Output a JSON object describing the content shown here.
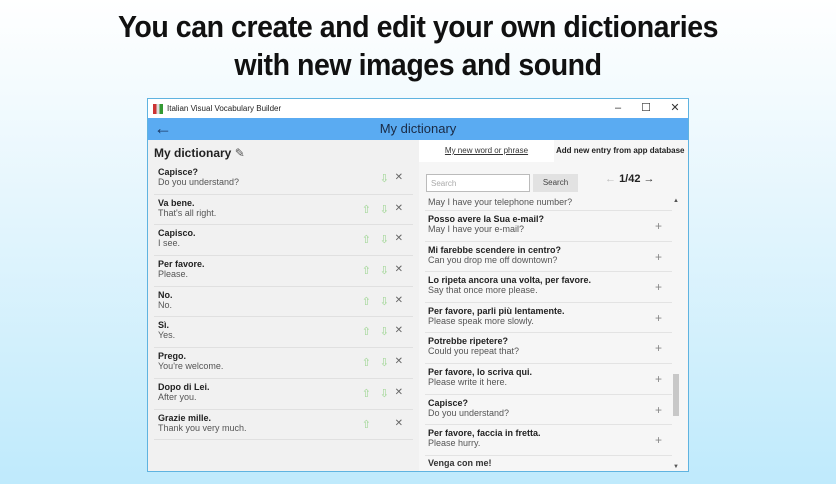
{
  "headline": [
    "You can create and edit your own dictionaries",
    "with new images and sound"
  ],
  "window": {
    "title": "Italian Visual Vocabulary Builder",
    "minimize": "–",
    "maximize": "☐",
    "close": "✕"
  },
  "header": {
    "title": "My dictionary",
    "back": "←"
  },
  "left": {
    "title": "My dictionary",
    "edit_icon": "✎",
    "items": [
      {
        "it": "Capisce?",
        "en": "Do you understand?",
        "up": false,
        "down": true
      },
      {
        "it": "Va bene.",
        "en": "That's all right.",
        "up": true,
        "down": true
      },
      {
        "it": "Capisco.",
        "en": "I see.",
        "up": true,
        "down": true
      },
      {
        "it": "Per favore.",
        "en": "Please.",
        "up": true,
        "down": true
      },
      {
        "it": "No.",
        "en": "No.",
        "up": true,
        "down": true
      },
      {
        "it": "Sì.",
        "en": "Yes.",
        "up": true,
        "down": true
      },
      {
        "it": "Prego.",
        "en": "You're welcome.",
        "up": true,
        "down": true
      },
      {
        "it": "Dopo di Lei.",
        "en": "After you.",
        "up": true,
        "down": true
      },
      {
        "it": "Grazie mille.",
        "en": "Thank you very much.",
        "up": true,
        "down": false
      }
    ]
  },
  "right": {
    "tab_new": "My new word or phrase",
    "tab_db": "Add new entry from app database",
    "search_placeholder": "Search",
    "search_button": "Search",
    "page": "1/42",
    "partial_top": "May I have your telephone number?",
    "items": [
      {
        "it": "Posso avere la Sua e-mail?",
        "en": "May I have your e-mail?"
      },
      {
        "it": "Mi farebbe scendere in centro?",
        "en": "Can you drop me off downtown?"
      },
      {
        "it": "Lo ripeta ancora una volta, per favore.",
        "en": "Say that once more please."
      },
      {
        "it": "Per favore, parli più lentamente.",
        "en": "Please speak more slowly."
      },
      {
        "it": "Potrebbe ripetere?",
        "en": "Could you repeat that?"
      },
      {
        "it": "Per favore, lo scriva qui.",
        "en": "Please write it here."
      },
      {
        "it": "Capisce?",
        "en": "Do you understand?"
      },
      {
        "it": "Per favore, faccia in fretta.",
        "en": "Please hurry."
      }
    ],
    "partial_bottom": "Venga con me!"
  }
}
